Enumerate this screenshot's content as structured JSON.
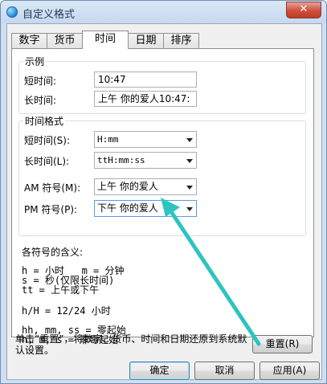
{
  "window": {
    "title": "自定义格式",
    "close_glyph": "✕"
  },
  "tabs": [
    {
      "label": "数字",
      "active": false
    },
    {
      "label": "货币",
      "active": false
    },
    {
      "label": "时间",
      "active": true
    },
    {
      "label": "日期",
      "active": false
    },
    {
      "label": "排序",
      "active": false
    }
  ],
  "example": {
    "group_title": "示例",
    "short_time_label": "短时间:",
    "short_time_value": "10:47",
    "long_time_label": "长时间:",
    "long_time_value": "上午  你的爱人10:47:"
  },
  "format": {
    "group_title": "时间格式",
    "short_time": {
      "label": "短时间(S):",
      "value": "H:mm"
    },
    "long_time": {
      "label": "长时间(L):",
      "value": "ttH:mm:ss"
    },
    "am": {
      "label": "AM 符号(M):",
      "value": "上午 你的爱人"
    },
    "pm": {
      "label": "PM 符号(P):",
      "value": "下午 你的爱人"
    }
  },
  "explanation": {
    "heading": "各符号的含义:",
    "line1": "h = 小时   m = 分钟",
    "line2": "s = 秒(仅限长时间)",
    "line3": "tt = 上午或下午",
    "line4": "h/H = 12/24 小时",
    "line5": "hh, mm, ss = 零起始",
    "line6": "h, m, s = 非零起始"
  },
  "reset_note": "单击“重置”，将数字、货币、时间和日期还原到系统默认设置。",
  "buttons": {
    "reset": "重置(R)",
    "ok": "确定",
    "cancel": "取消",
    "apply": "应用(A)"
  },
  "watermark": "Baidu 经验",
  "colors": {
    "arrow": "#2ec4c0",
    "title_text": "#1e395b"
  }
}
